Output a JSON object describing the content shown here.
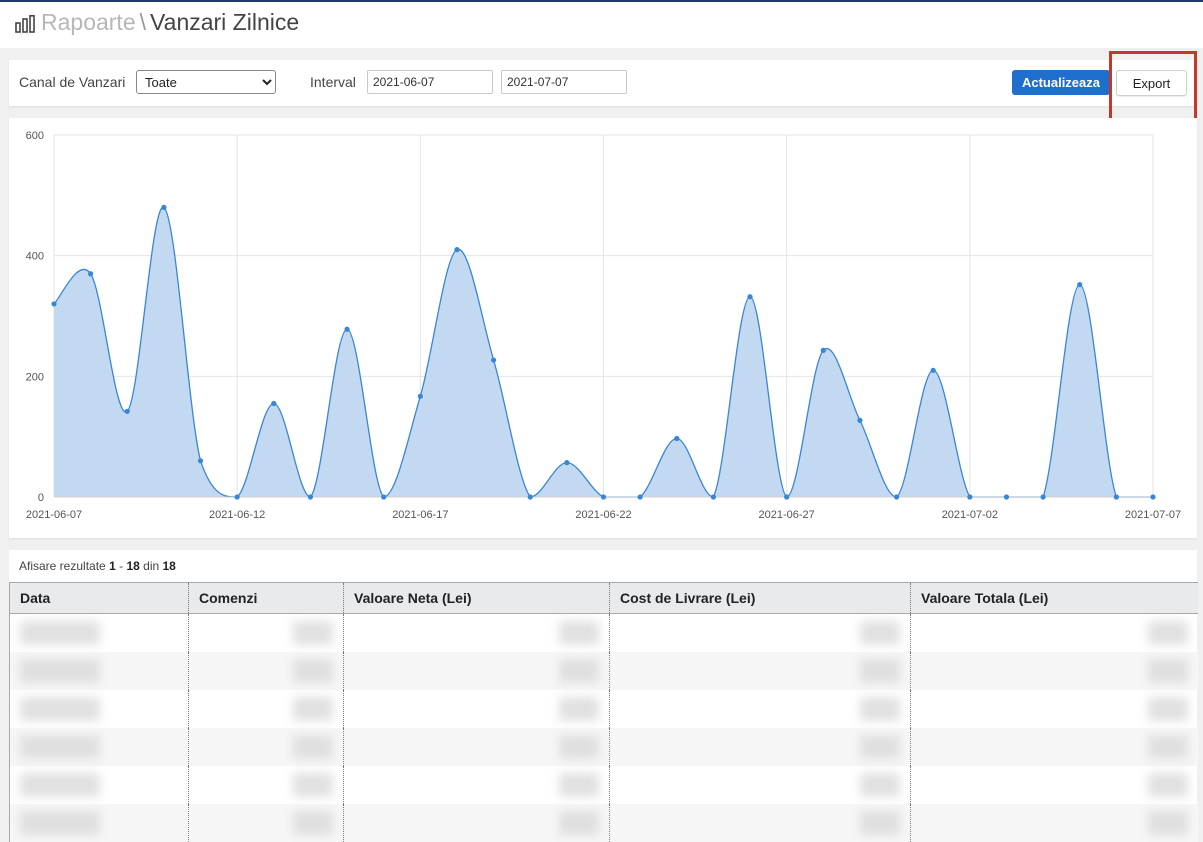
{
  "header": {
    "breadcrumb_parent": "Rapoarte",
    "separator": "\\",
    "page_title": "Vanzari Zilnice",
    "icon": "bar-chart-icon"
  },
  "filters": {
    "channel_label": "Canal de Vanzari",
    "channel_selected": "Toate",
    "interval_label": "Interval",
    "date_from": "2021-06-07",
    "date_to": "2021-07-07",
    "update_button": "Actualizeaza",
    "export_button": "Export"
  },
  "colors": {
    "accent": "#1f6fce",
    "series_line": "#3a86d6",
    "series_fill": "#c3d8f1",
    "highlight": "#c0392b"
  },
  "chart_data": {
    "type": "area",
    "x": [
      "2021-06-07",
      "2021-06-08",
      "2021-06-09",
      "2021-06-10",
      "2021-06-11",
      "2021-06-12",
      "2021-06-13",
      "2021-06-14",
      "2021-06-15",
      "2021-06-16",
      "2021-06-17",
      "2021-06-18",
      "2021-06-19",
      "2021-06-20",
      "2021-06-21",
      "2021-06-22",
      "2021-06-23",
      "2021-06-24",
      "2021-06-25",
      "2021-06-26",
      "2021-06-27",
      "2021-06-28",
      "2021-06-29",
      "2021-06-30",
      "2021-07-01",
      "2021-07-02",
      "2021-07-03",
      "2021-07-04",
      "2021-07-05",
      "2021-07-06",
      "2021-07-07"
    ],
    "values": [
      320,
      370,
      142,
      480,
      60,
      0,
      155,
      0,
      278,
      0,
      167,
      410,
      227,
      0,
      57,
      0,
      0,
      97,
      0,
      332,
      0,
      243,
      127,
      0,
      210,
      0,
      0,
      0,
      352,
      0,
      0
    ],
    "x_tick_labels": [
      "2021-06-07",
      "2021-06-12",
      "2021-06-17",
      "2021-06-22",
      "2021-06-27",
      "2021-07-02",
      "2021-07-07"
    ],
    "y_tick_labels": [
      "0",
      "200",
      "400",
      "600"
    ],
    "ylim": [
      0,
      600
    ],
    "grid": true,
    "smooth": true
  },
  "table": {
    "summary_prefix": "Afisare rezultate",
    "range_start": "1",
    "range_dash": "-",
    "range_end": "18",
    "of_label": "din",
    "total": "18",
    "columns": [
      "Data",
      "Comenzi",
      "Valoare Neta (Lei)",
      "Cost de Livrare (Lei)",
      "Valoare Totala (Lei)"
    ]
  }
}
